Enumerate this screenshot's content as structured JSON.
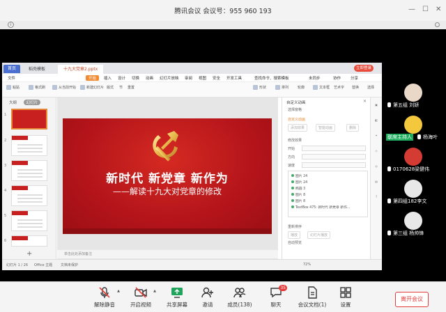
{
  "window": {
    "title": "腾讯会议  会议号：955 960 193"
  },
  "wps": {
    "tabs": [
      "首页",
      "稻壳模板",
      "十九大党章2.pptx"
    ],
    "login": "立即登录",
    "menu": [
      "文件",
      "开始",
      "插入",
      "设计",
      "切换",
      "动画",
      "幻灯片放映",
      "审阅",
      "视图",
      "安全",
      "开发工具",
      "查找命令、搜索模板",
      "未同步",
      "协作",
      "分享"
    ],
    "ribbon": [
      "粘贴",
      "格式刷",
      "从当前开始",
      "新建幻灯片",
      "版式",
      "节",
      "重置",
      "形状",
      "排列",
      "轮廓",
      "文本框",
      "艺术字",
      "替换",
      "选择"
    ],
    "thumbs_tabs": [
      "大纲",
      "幻灯片"
    ],
    "slide_numbers": [
      "1",
      "2",
      "3",
      "4",
      "5",
      "6"
    ],
    "note_placeholder": "单击此处添加备注",
    "panel": {
      "title": "自定义动画",
      "select": "选择窗格",
      "custom": "自定义动画",
      "add_effect": "添加效果",
      "smart": "智能动画",
      "delete": "删除",
      "modify": "修改效果",
      "start_label": "开始",
      "dir_label": "方向",
      "speed_label": "速度",
      "items": [
        "图片 24",
        "图片 24",
        "椭圆 3",
        "图片 8",
        "图片 8",
        "TextBox 475: 新时代 新党章 新作..."
      ],
      "reorder": "重新排序",
      "play": "播放",
      "slideshow": "幻灯片播放",
      "autopreview": "自动预览"
    },
    "status": [
      "幻灯片 1 / 26",
      "Office 主题",
      "文档未保护"
    ],
    "zoom": "72%"
  },
  "slide": {
    "title": "新时代 新党章 新作为",
    "subtitle": "——解读十九大对党章的修改"
  },
  "participants": [
    {
      "name": "第五组 刘妍"
    },
    {
      "name": "杨海叶",
      "host": "联席主持人"
    },
    {
      "name": "0170628梁健伟"
    },
    {
      "name": "第四组182李文"
    },
    {
      "name": "第三组 杨帅锋"
    }
  ],
  "toolbar": {
    "mute": "解除静音",
    "video": "开启视频",
    "share": "共享屏幕",
    "invite": "邀请",
    "members": "成员(138)",
    "chat": "聊天",
    "chat_badge": "35",
    "docs": "会议文档(1)",
    "settings": "设置",
    "leave": "离开会议"
  }
}
